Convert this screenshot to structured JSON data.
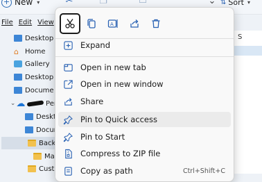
{
  "toolbar": {
    "new_label": "New",
    "sort_label": "Sort"
  },
  "menubar": {
    "file": "File",
    "edit": "Edit",
    "view": "View"
  },
  "nav": {
    "items": [
      {
        "label": "Desktop",
        "icon": "folder-blue-icon"
      },
      {
        "label": "Home",
        "icon": "home-icon"
      },
      {
        "label": "Gallery",
        "icon": "gallery-icon"
      },
      {
        "label": "Desktop",
        "icon": "folder-blue-icon"
      },
      {
        "label": "Docume",
        "icon": "folder-blue-icon"
      },
      {
        "label": "Per",
        "icon": "cloud-icon"
      },
      {
        "label": "Deskto",
        "icon": "folder-blue-icon"
      },
      {
        "label": "Docum",
        "icon": "folder-blue-icon"
      },
      {
        "label": "Backg",
        "icon": "folder-yellow-icon"
      },
      {
        "label": "Mat",
        "icon": "folder-yellow-icon"
      },
      {
        "label": "Custo",
        "icon": "folder-yellow-icon"
      }
    ]
  },
  "right_panel": {
    "column_initial": "S"
  },
  "context_menu": {
    "quick_actions": [
      {
        "name": "cut",
        "active": true
      },
      {
        "name": "copy",
        "active": false
      },
      {
        "name": "rename",
        "active": false
      },
      {
        "name": "share",
        "active": false
      },
      {
        "name": "delete",
        "active": false
      }
    ],
    "items": [
      {
        "label": "Expand",
        "icon": "expand-icon",
        "shortcut": ""
      },
      {
        "label": "Open in new tab",
        "icon": "new-tab-icon",
        "shortcut": ""
      },
      {
        "label": "Open in new window",
        "icon": "new-window-icon",
        "shortcut": ""
      },
      {
        "label": "Share",
        "icon": "share-icon",
        "shortcut": ""
      },
      {
        "label": "Pin to Quick access",
        "icon": "pin-icon",
        "shortcut": ""
      },
      {
        "label": "Pin to Start",
        "icon": "pin-icon",
        "shortcut": ""
      },
      {
        "label": "Compress to ZIP file",
        "icon": "zip-icon",
        "shortcut": ""
      },
      {
        "label": "Copy as path",
        "icon": "copy-path-icon",
        "shortcut": "Ctrl+Shift+C"
      }
    ],
    "hovered_item": "Pin to Quick access"
  }
}
